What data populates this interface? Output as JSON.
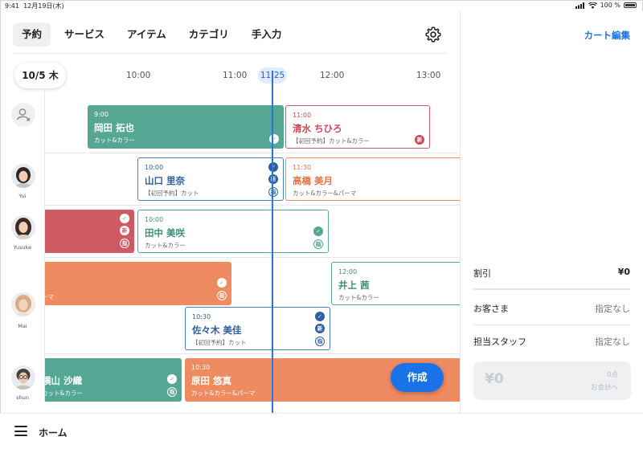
{
  "status": {
    "time": "9:41",
    "date": "12月19日(木)",
    "battery": "100 %"
  },
  "nav": {
    "tabs": [
      "予約",
      "サービス",
      "アイテム",
      "カテゴリ",
      "手入力"
    ]
  },
  "date_label": "10/5 木",
  "times": {
    "t1000": "10:00",
    "t1100": "11:00",
    "now": "11:25",
    "t1200": "12:00",
    "t1300": "13:00"
  },
  "staff": [
    {
      "name": "Yui"
    },
    {
      "name": "Yusuke"
    },
    {
      "name": "Mai"
    },
    {
      "name": "shun"
    }
  ],
  "appointments": {
    "a1": {
      "time": "9:00",
      "name": "岡田 拓也",
      "service": "カット&カラー"
    },
    "a2": {
      "time": "11:00",
      "name": "清水 ちひろ",
      "service": "【初回予約】カット&カラー"
    },
    "a3": {
      "time": "10:00",
      "name": "山口 里奈",
      "service": "【初回予約】カット"
    },
    "a4": {
      "time": "11:30",
      "name": "高橋 美月",
      "service": "カット&カラー&パーマ"
    },
    "a6": {
      "time": "10:00",
      "name": "田中 美咲",
      "service": "カット&カラー"
    },
    "a7": {
      "service": "ーマ"
    },
    "a8": {
      "time": "12:00",
      "name": "井上 茜",
      "service": "カット&カラー"
    },
    "a9": {
      "time": "10:30",
      "name": "佐々木 美佳",
      "service": "【初回予約】カット"
    },
    "a10": {
      "name": "横山 沙織",
      "service": "カット&カラー"
    },
    "a11": {
      "time": "10:30",
      "name": "原田 悠真",
      "service": "カット&カラー&パーマ"
    }
  },
  "badges": {
    "new": "新",
    "designated": "指",
    "check": "✓"
  },
  "create_label": "作成",
  "right": {
    "cart_edit": "カート編集",
    "discount_label": "割引",
    "discount_value": "¥0",
    "customer_label": "お客さま",
    "customer_value": "指定なし",
    "staff_label": "担当スタッフ",
    "staff_value": "指定なし",
    "pay_amount": "¥0",
    "pay_points": "0点",
    "pay_to": "お会計へ"
  },
  "bottom": {
    "home": "ホーム"
  },
  "colors": {
    "accent": "#1a72e8",
    "green": "#55a692",
    "red": "#d05a64",
    "orange": "#ee8b61",
    "blue": "#2f5f9f"
  }
}
